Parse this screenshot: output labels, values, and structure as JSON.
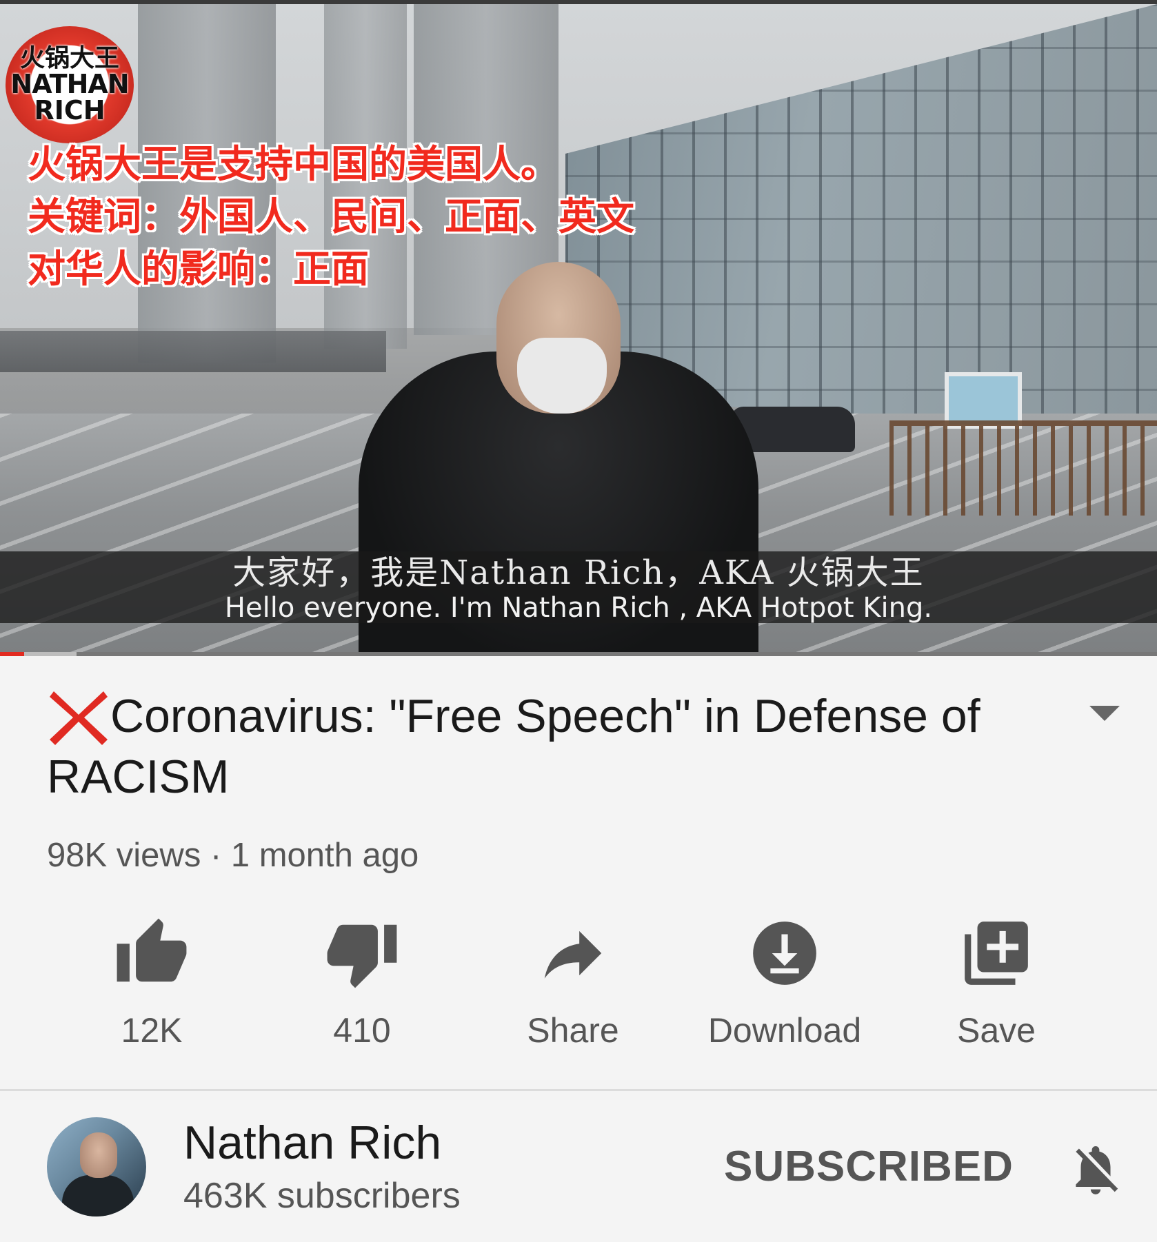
{
  "video": {
    "logo_line1": "火锅大王",
    "logo_line2": "NATHAN",
    "logo_line3": "RICH",
    "overlay_lines": [
      "火锅大王是支持中国的美国人。",
      "关键词：外国人、民间、正面、英文",
      "对华人的影响：正面"
    ],
    "subtitle_zh": "大家好，我是Nathan Rich，AKA 火锅大王",
    "subtitle_en": "Hello everyone. I'm Nathan Rich , AKA Hotpot King.",
    "progress_played_fraction": 0.021,
    "progress_buffered_fraction": 0.066,
    "accent_color": "#e22b20"
  },
  "info": {
    "title": "Coronavirus: \"Free Speech\" in Defense of RACISM",
    "title_prefix_icon": "red-x-icon",
    "views": "98K views",
    "separator": " · ",
    "uploaded": "1 month ago"
  },
  "actions": {
    "like": {
      "icon": "thumbs-up-icon",
      "label": "12K"
    },
    "dislike": {
      "icon": "thumbs-down-icon",
      "label": "410"
    },
    "share": {
      "icon": "share-arrow-icon",
      "label": "Share"
    },
    "download": {
      "icon": "download-icon",
      "label": "Download"
    },
    "save": {
      "icon": "add-to-playlist-icon",
      "label": "Save"
    }
  },
  "channel": {
    "name": "Nathan Rich",
    "subscribers": "463K subscribers",
    "subscribe_state": "SUBSCRIBED",
    "notification_icon": "bell-off-icon"
  }
}
